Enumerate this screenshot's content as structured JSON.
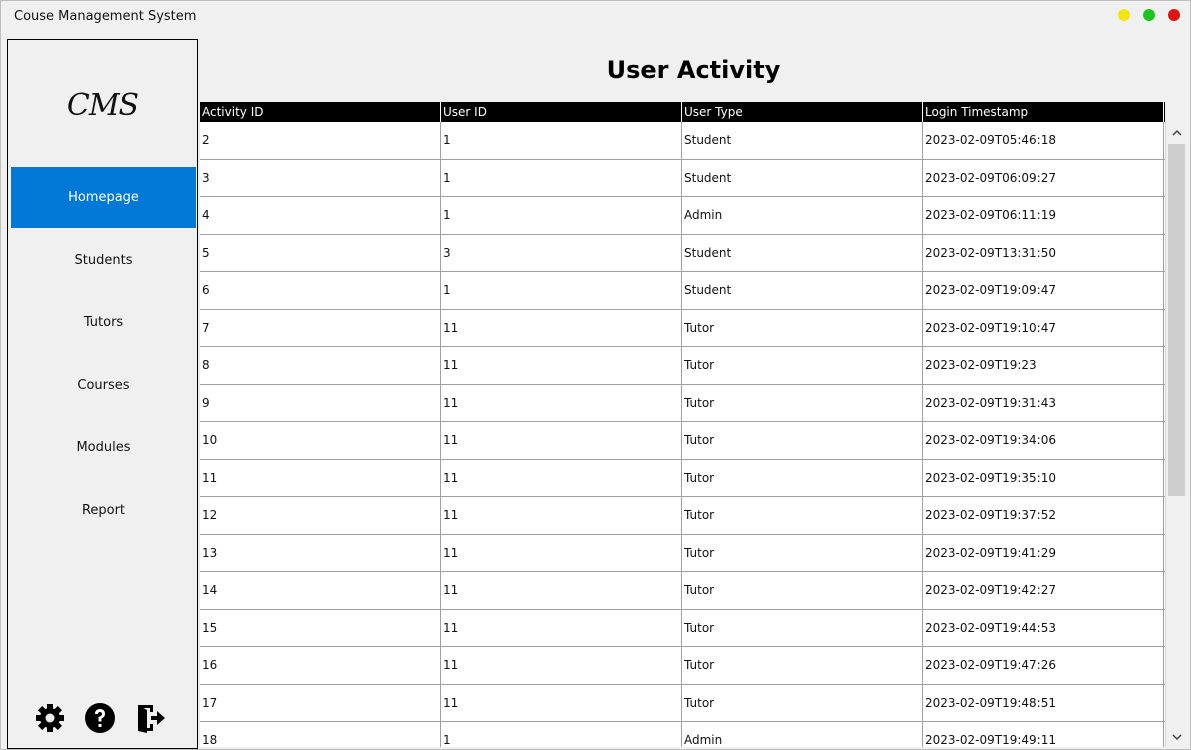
{
  "window": {
    "title": "Couse Management System",
    "controls": [
      {
        "name": "minimize-dot",
        "color": "#f1e612"
      },
      {
        "name": "maximize-dot",
        "color": "#1ec420"
      },
      {
        "name": "close-dot",
        "color": "#e11212"
      }
    ]
  },
  "sidebar": {
    "logo": "CMS",
    "items": [
      {
        "label": "Homepage",
        "active": true
      },
      {
        "label": "Students"
      },
      {
        "label": "Tutors"
      },
      {
        "label": "Courses"
      },
      {
        "label": "Modules"
      },
      {
        "label": "Report"
      }
    ],
    "bottom_icons": [
      "gear-icon",
      "help-icon",
      "logout-icon"
    ]
  },
  "main": {
    "title": "User Activity",
    "columns": [
      "Activity ID",
      "User ID",
      "User Type",
      "Login Timestamp"
    ],
    "rows": [
      [
        "2",
        "1",
        "Student",
        "2023-02-09T05:46:18"
      ],
      [
        "3",
        "1",
        "Student",
        "2023-02-09T06:09:27"
      ],
      [
        "4",
        "1",
        "Admin",
        "2023-02-09T06:11:19"
      ],
      [
        "5",
        "3",
        "Student",
        "2023-02-09T13:31:50"
      ],
      [
        "6",
        "1",
        "Student",
        "2023-02-09T19:09:47"
      ],
      [
        "7",
        "11",
        "Tutor",
        "2023-02-09T19:10:47"
      ],
      [
        "8",
        "11",
        "Tutor",
        "2023-02-09T19:23"
      ],
      [
        "9",
        "11",
        "Tutor",
        "2023-02-09T19:31:43"
      ],
      [
        "10",
        "11",
        "Tutor",
        "2023-02-09T19:34:06"
      ],
      [
        "11",
        "11",
        "Tutor",
        "2023-02-09T19:35:10"
      ],
      [
        "12",
        "11",
        "Tutor",
        "2023-02-09T19:37:52"
      ],
      [
        "13",
        "11",
        "Tutor",
        "2023-02-09T19:41:29"
      ],
      [
        "14",
        "11",
        "Tutor",
        "2023-02-09T19:42:27"
      ],
      [
        "15",
        "11",
        "Tutor",
        "2023-02-09T19:44:53"
      ],
      [
        "16",
        "11",
        "Tutor",
        "2023-02-09T19:47:26"
      ],
      [
        "17",
        "11",
        "Tutor",
        "2023-02-09T19:48:51"
      ],
      [
        "18",
        "1",
        "Admin",
        "2023-02-09T19:49:11"
      ]
    ]
  },
  "colors": {
    "accent": "#0078d7",
    "header_bg": "#000000"
  }
}
